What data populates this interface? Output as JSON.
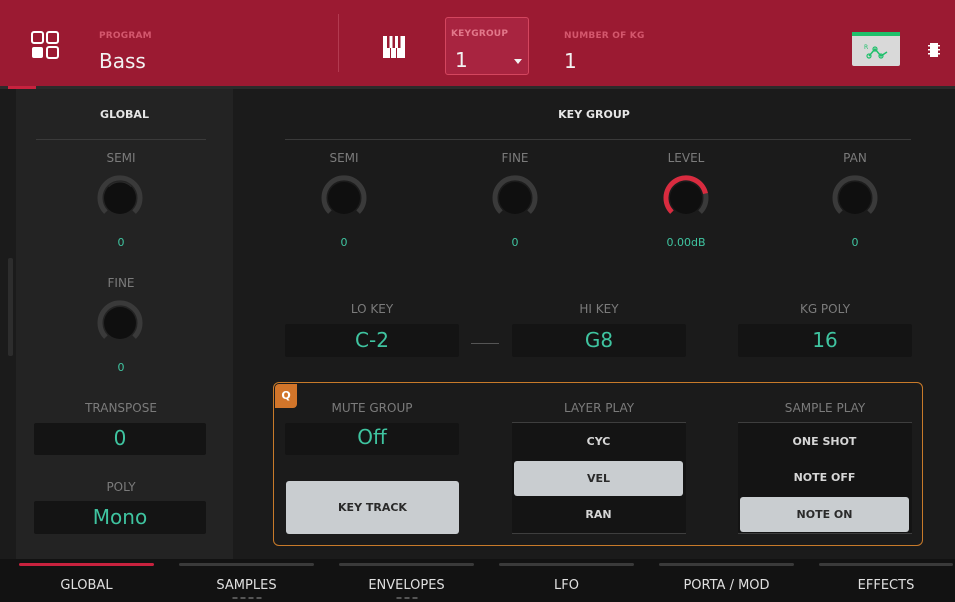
{
  "header": {
    "program_label": "PROGRAM",
    "program_value": "Bass",
    "keygroup_label": "KEYGROUP",
    "keygroup_value": "1",
    "num_kg_label": "NUMBER OF KG",
    "num_kg_value": "1",
    "icons": [
      "grid-menu-icon",
      "piano-keys-icon",
      "caret-down-icon",
      "mod-routing-icon",
      "chip-icon"
    ],
    "accent_color": "#9b1a32"
  },
  "global": {
    "title": "GLOBAL",
    "semi_label": "SEMI",
    "semi_value": "0",
    "fine_label": "FINE",
    "fine_value": "0",
    "transpose_label": "TRANSPOSE",
    "transpose_value": "0",
    "poly_label": "POLY",
    "poly_value": "Mono"
  },
  "keygroup": {
    "title": "KEY GROUP",
    "semi_label": "SEMI",
    "semi_value": "0",
    "fine_label": "FINE",
    "fine_value": "0",
    "level_label": "LEVEL",
    "level_value": "0.00dB",
    "pan_label": "PAN",
    "pan_value": "0",
    "lo_key_label": "LO KEY",
    "lo_key_value": "C-2",
    "hi_key_label": "HI KEY",
    "hi_key_value": "G8",
    "kg_poly_label": "KG POLY",
    "kg_poly_value": "16"
  },
  "q_section": {
    "badge": "Q",
    "mute_group_label": "MUTE GROUP",
    "mute_group_value": "Off",
    "key_track_label": "KEY TRACK",
    "layer_play_label": "LAYER PLAY",
    "layer_play_options": [
      "CYC",
      "VEL",
      "RAN"
    ],
    "layer_play_selected": "VEL",
    "sample_play_label": "SAMPLE PLAY",
    "sample_play_options": [
      "ONE SHOT",
      "NOTE OFF",
      "NOTE ON"
    ],
    "sample_play_selected": "NOTE ON",
    "accent_color": "#d2752a"
  },
  "tabs": [
    {
      "label": "GLOBAL",
      "active": true
    },
    {
      "label": "SAMPLES",
      "active": false
    },
    {
      "label": "ENVELOPES",
      "active": false
    },
    {
      "label": "LFO",
      "active": false
    },
    {
      "label": "PORTA / MOD",
      "active": false
    },
    {
      "label": "EFFECTS",
      "active": false
    }
  ],
  "colors": {
    "value_teal": "#3fc4a0",
    "level_red": "#d92b3f"
  }
}
